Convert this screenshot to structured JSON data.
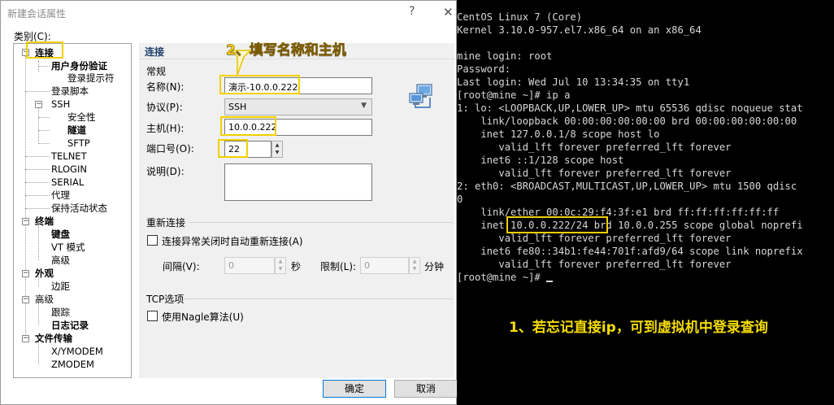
{
  "dialog": {
    "title": "新建会话属性",
    "help": "?",
    "close": "✕",
    "category_label": "类别(C):",
    "tree": [
      {
        "label": "连接",
        "bold": true
      },
      {
        "label": "用户身份验证",
        "bold": true
      },
      {
        "label": "登录提示符",
        "bold": false
      },
      {
        "label": "登录脚本",
        "bold": false
      },
      {
        "label": "SSH",
        "bold": false
      },
      {
        "label": "安全性",
        "bold": false
      },
      {
        "label": "隧道",
        "bold": true
      },
      {
        "label": "SFTP",
        "bold": false
      },
      {
        "label": "TELNET",
        "bold": false
      },
      {
        "label": "RLOGIN",
        "bold": false
      },
      {
        "label": "SERIAL",
        "bold": false
      },
      {
        "label": "代理",
        "bold": false
      },
      {
        "label": "保持活动状态",
        "bold": false
      },
      {
        "label": "终端",
        "bold": true
      },
      {
        "label": "键盘",
        "bold": true
      },
      {
        "label": "VT 模式",
        "bold": false
      },
      {
        "label": "高级",
        "bold": false
      },
      {
        "label": "外观",
        "bold": true
      },
      {
        "label": "边距",
        "bold": false
      },
      {
        "label": "高级",
        "bold": false
      },
      {
        "label": "跟踪",
        "bold": false
      },
      {
        "label": "日志记录",
        "bold": true
      },
      {
        "label": "文件传输",
        "bold": true
      },
      {
        "label": "X/YMODEM",
        "bold": false
      },
      {
        "label": "ZMODEM",
        "bold": false
      }
    ],
    "panel_title": "连接",
    "general": {
      "section": "常规",
      "name_label": "名称(N):",
      "name_value": "演示-10.0.0.222",
      "protocol_label": "协议(P):",
      "protocol_value": "SSH",
      "host_label": "主机(H):",
      "host_value": "10.0.0.222",
      "port_label": "端口号(O):",
      "port_value": "22",
      "desc_label": "说明(D):"
    },
    "reconnect": {
      "section": "重新连接",
      "checkbox_label": "连接异常关闭时自动重新连接(A)",
      "interval_label": "间隔(V):",
      "interval_value": "0",
      "interval_unit": "秒",
      "limit_label": "限制(L):",
      "limit_value": "0",
      "limit_unit": "分钟"
    },
    "tcp": {
      "section": "TCP选项",
      "nagle_label": "使用Nagle算法(U)"
    },
    "ok_label": "确定",
    "cancel_label": "取消"
  },
  "annotations": {
    "step2": "2、填写名称和主机",
    "step1": "1、若忘记直接ip，可到虚拟机中登录查询",
    "color": "#ffd400"
  },
  "terminal": {
    "lines": [
      "CentOS Linux 7 (Core)",
      "Kernel 3.10.0-957.el7.x86_64 on an x86_64",
      "",
      "mine login: root",
      "Password:",
      "Last login: Wed Jul 10 13:34:35 on tty1",
      "[root@mine ~]# ip a",
      "1: lo: <LOOPBACK,UP,LOWER_UP> mtu 65536 qdisc noqueue stat",
      "    link/loopback 00:00:00:00:00:00 brd 00:00:00:00:00:00",
      "    inet 127.0.0.1/8 scope host lo",
      "       valid_lft forever preferred_lft forever",
      "    inet6 ::1/128 scope host",
      "       valid_lft forever preferred_lft forever",
      "2: eth0: <BROADCAST,MULTICAST,UP,LOWER_UP> mtu 1500 qdisc",
      "0",
      "    link/ether 00:0c:29:f4:3f:e1 brd ff:ff:ff:ff:ff:ff",
      "    inet 10.0.0.222/24 brd 10.0.0.255 scope global noprefi",
      "       valid_lft forever preferred_lft forever",
      "    inet6 fe80::34b1:fe44:701f:afd9/64 scope link noprefix",
      "       valid_lft forever preferred_lft forever",
      "[root@mine ~]# "
    ],
    "background": "#000000",
    "foreground": "#d8d8d8"
  }
}
